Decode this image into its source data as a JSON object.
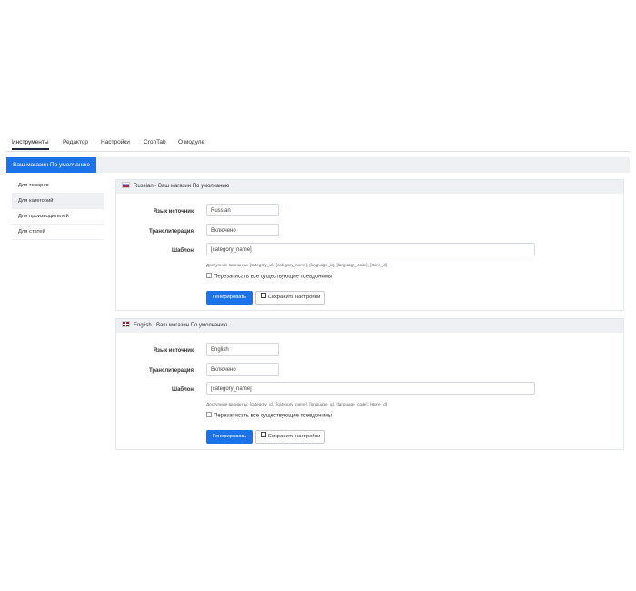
{
  "tabs": [
    {
      "label": "Инструменты"
    },
    {
      "label": "Редактор"
    },
    {
      "label": "Настройки"
    },
    {
      "label": "CronTab"
    },
    {
      "label": "О модуле"
    }
  ],
  "store_tab": "Ваш магазин По умолчанию",
  "menu": [
    {
      "label": "Для товаров"
    },
    {
      "label": "Для категорий"
    },
    {
      "label": "Для производителей"
    },
    {
      "label": "Для статей"
    }
  ],
  "panels": [
    {
      "title": "Russian - Ваш магазин По умолчанию",
      "source_label": "Язык источник",
      "source_value": "Russian",
      "translit_label": "Транслитерация",
      "translit_value": "Включено",
      "template_label": "Шаблон",
      "template_value": "[category_name]",
      "hint": "Доступные варианты: [category_id], [category_name], [language_id], [language_code], [store_id]",
      "overwrite_label": "Перезаписать все существующие псевдонимы",
      "generate_label": "Генерировать",
      "save_label": "Сохранить настройки"
    },
    {
      "title": "English - Ваш магазин По умолчанию",
      "source_label": "Язык источник",
      "source_value": "English",
      "translit_label": "Транслитерация",
      "translit_value": "Включено",
      "template_label": "Шаблон",
      "template_value": "[category_name]",
      "hint": "Доступные варианты: [category_id], [category_name], [language_id], [language_code], [store_id]",
      "overwrite_label": "Перезаписать все существующие псевдонимы",
      "generate_label": "Генерировать",
      "save_label": "Сохранить настройки"
    }
  ],
  "colors": {
    "accent": "#1a73e8",
    "header_bg": "#eef0f3"
  }
}
